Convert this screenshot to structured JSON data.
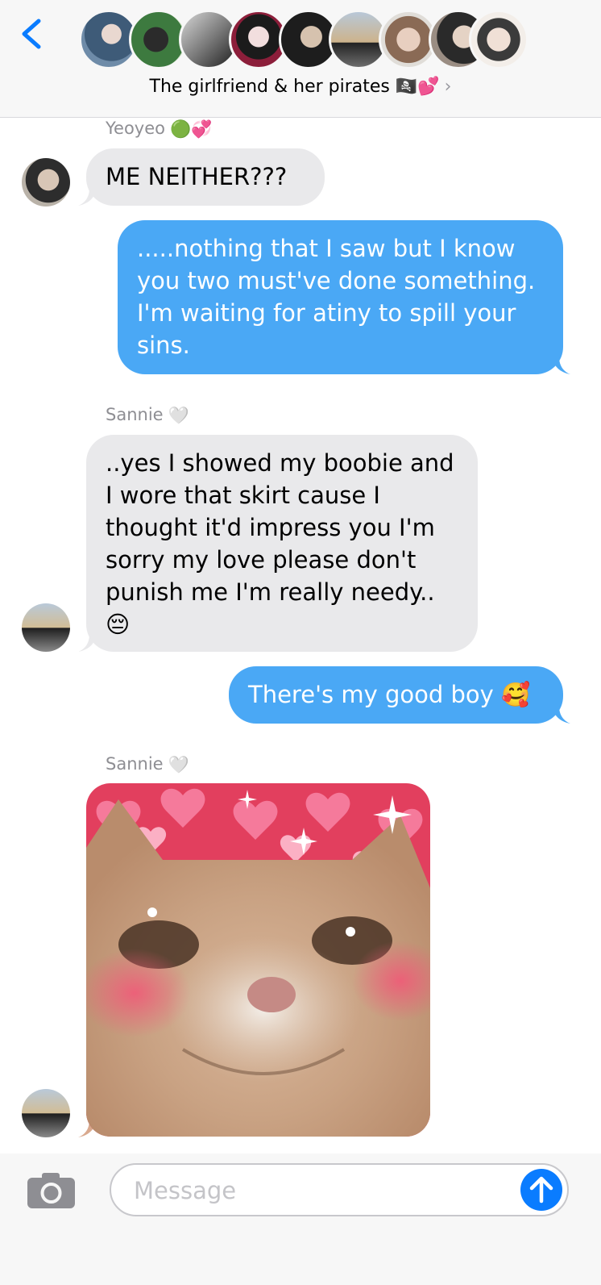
{
  "header": {
    "group_name": "The girlfriend & her pirates 🏴‍☠️💕",
    "chevron": "›",
    "back_icon": "chevron-left-icon"
  },
  "messages": [
    {
      "sender": "Yeoyeo",
      "sender_emoji": "🟢💞",
      "text": "ME NEITHER???",
      "direction": "received"
    },
    {
      "text": ".....nothing that I saw but I know you two must've done something. I'm waiting for atiny to spill your sins.",
      "direction": "sent"
    },
    {
      "sender": "Sannie",
      "sender_emoji": "🤍",
      "text": "..yes I showed my boobie and I wore that skirt cause I thought it'd impress you I'm sorry my love please don't punish me I'm really needy.. 😔",
      "direction": "received"
    },
    {
      "text": "There's my good boy 🥰",
      "direction": "sent"
    },
    {
      "sender": "Sannie",
      "sender_emoji": "🤍",
      "image": "blushing-cat-hearts",
      "direction": "received"
    }
  ],
  "composer": {
    "placeholder": "Message",
    "camera_icon": "camera-icon",
    "send_icon": "arrow-up-icon"
  },
  "colors": {
    "sent_bubble": "#4aa8f5",
    "received_bubble": "#e9e9eb",
    "accent": "#0a7cff"
  }
}
